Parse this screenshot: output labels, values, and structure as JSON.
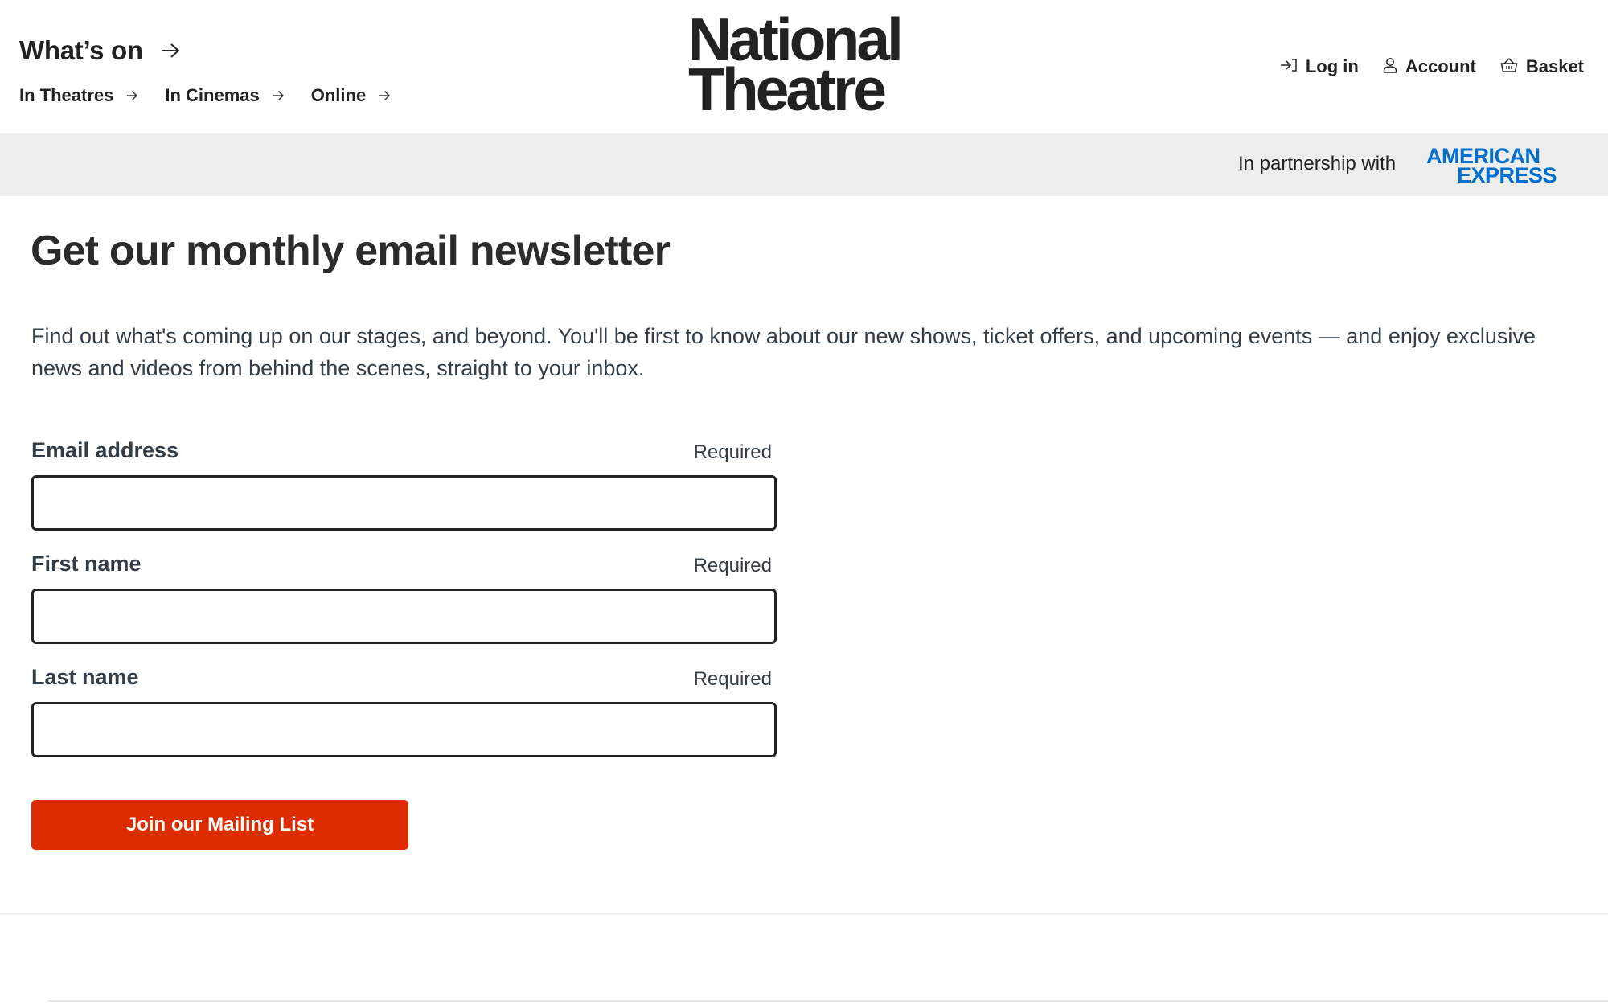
{
  "header": {
    "whats_on": {
      "label": "What’s on",
      "icon": "arrow-right-icon"
    },
    "subnav": [
      {
        "label": "In Theatres",
        "icon": "arrow-right-icon"
      },
      {
        "label": "In Cinemas",
        "icon": "arrow-right-icon"
      },
      {
        "label": "Online",
        "icon": "arrow-right-icon"
      }
    ],
    "logo": {
      "line1": "National",
      "line2": "Theatre"
    },
    "utility": [
      {
        "label": "Log in",
        "icon": "login-icon"
      },
      {
        "label": "Account",
        "icon": "user-icon"
      },
      {
        "label": "Basket",
        "icon": "basket-icon"
      }
    ]
  },
  "partnership": {
    "text": "In partnership with",
    "sponsor_line1": "AMERICAN",
    "sponsor_line2": "EXPRESS",
    "sponsor_color": "#006fcf"
  },
  "main": {
    "headline": "Get our monthly email newsletter",
    "intro": "Find out what's coming up on our stages, and beyond. You'll be first to know about our new shows, ticket offers, and upcoming events — and enjoy exclusive news and videos from behind the scenes, straight to your inbox.",
    "form": {
      "fields": [
        {
          "label": "Email address",
          "required_label": "Required",
          "value": "",
          "placeholder": ""
        },
        {
          "label": "First name",
          "required_label": "Required",
          "value": "",
          "placeholder": ""
        },
        {
          "label": "Last name",
          "required_label": "Required",
          "value": "",
          "placeholder": ""
        }
      ],
      "submit_label": "Join our Mailing List",
      "submit_color": "#dd2c00"
    }
  }
}
